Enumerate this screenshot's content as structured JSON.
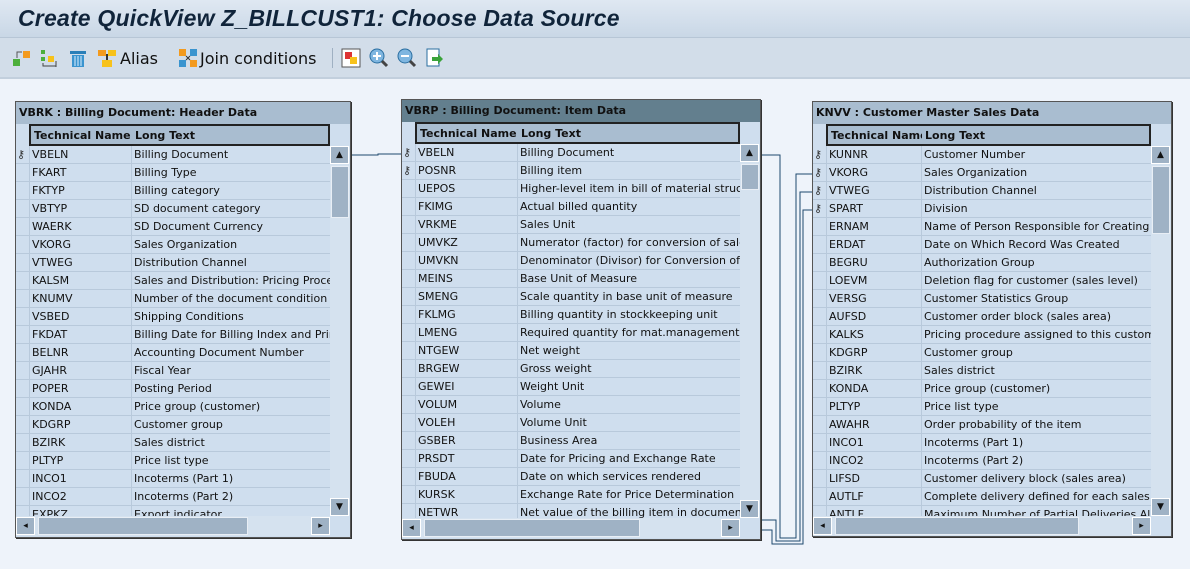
{
  "title": "Create QuickView Z_BILLCUST1: Choose Data Source",
  "toolbar": {
    "alias": "Alias",
    "join": "Join conditions"
  },
  "colors": {
    "line": "#1f4a6e",
    "header": "#a9bdd0",
    "selected_header": "#637f8e"
  },
  "tables": [
    {
      "title": "VBRK : Billing Document: Header Data",
      "col_tech": "Technical Name",
      "col_long": "Long Text",
      "rows": [
        [
          "VBELN",
          "Billing Document",
          true
        ],
        [
          "FKART",
          "Billing Type",
          false
        ],
        [
          "FKTYP",
          "Billing category",
          false
        ],
        [
          "VBTYP",
          "SD document category",
          false
        ],
        [
          "WAERK",
          "SD Document Currency",
          false
        ],
        [
          "VKORG",
          "Sales Organization",
          false
        ],
        [
          "VTWEG",
          "Distribution Channel",
          false
        ],
        [
          "KALSM",
          "Sales and Distribution: Pricing Procedure",
          false
        ],
        [
          "KNUMV",
          "Number of the document condition",
          false
        ],
        [
          "VSBED",
          "Shipping Conditions",
          false
        ],
        [
          "FKDAT",
          "Billing Date for Billing Index and Printout",
          false
        ],
        [
          "BELNR",
          "Accounting Document Number",
          false
        ],
        [
          "GJAHR",
          "Fiscal Year",
          false
        ],
        [
          "POPER",
          "Posting Period",
          false
        ],
        [
          "KONDA",
          "Price group (customer)",
          false
        ],
        [
          "KDGRP",
          "Customer group",
          false
        ],
        [
          "BZIRK",
          "Sales district",
          false
        ],
        [
          "PLTYP",
          "Price list type",
          false
        ],
        [
          "INCO1",
          "Incoterms (Part 1)",
          false
        ],
        [
          "INCO2",
          "Incoterms (Part 2)",
          false
        ],
        [
          "EXPKZ",
          "Export indicator",
          false
        ]
      ]
    },
    {
      "title": "VBRP : Billing Document: Item Data",
      "col_tech": "Technical Name",
      "col_long": "Long Text",
      "rows": [
        [
          "VBELN",
          "Billing Document",
          true
        ],
        [
          "POSNR",
          "Billing item",
          true
        ],
        [
          "UEPOS",
          "Higher-level item in bill of material structures",
          false
        ],
        [
          "FKIMG",
          "Actual billed quantity",
          false
        ],
        [
          "VRKME",
          "Sales Unit",
          false
        ],
        [
          "UMVKZ",
          "Numerator (factor) for conversion of sales quantity",
          false
        ],
        [
          "UMVKN",
          "Denominator (Divisor) for Conversion of Sales Qty",
          false
        ],
        [
          "MEINS",
          "Base Unit of Measure",
          false
        ],
        [
          "SMENG",
          "Scale quantity in base unit of measure",
          false
        ],
        [
          "FKLMG",
          "Billing quantity in stockkeeping unit",
          false
        ],
        [
          "LMENG",
          "Required quantity for mat.management in stock",
          false
        ],
        [
          "NTGEW",
          "Net weight",
          false
        ],
        [
          "BRGEW",
          "Gross weight",
          false
        ],
        [
          "GEWEI",
          "Weight Unit",
          false
        ],
        [
          "VOLUM",
          "Volume",
          false
        ],
        [
          "VOLEH",
          "Volume Unit",
          false
        ],
        [
          "GSBER",
          "Business Area",
          false
        ],
        [
          "PRSDT",
          "Date for Pricing and Exchange Rate",
          false
        ],
        [
          "FBUDA",
          "Date on which services rendered",
          false
        ],
        [
          "KURSK",
          "Exchange Rate for Price Determination",
          false
        ],
        [
          "NETWR",
          "Net value of the billing item in document currency",
          false
        ]
      ]
    },
    {
      "title": "KNVV : Customer Master Sales Data",
      "col_tech": "Technical Name",
      "col_long": "Long Text",
      "rows": [
        [
          "KUNNR",
          "Customer Number",
          true
        ],
        [
          "VKORG",
          "Sales Organization",
          true
        ],
        [
          "VTWEG",
          "Distribution Channel",
          true
        ],
        [
          "SPART",
          "Division",
          true
        ],
        [
          "ERNAM",
          "Name of Person Responsible for Creating the Object",
          false
        ],
        [
          "ERDAT",
          "Date on Which Record Was Created",
          false
        ],
        [
          "BEGRU",
          "Authorization Group",
          false
        ],
        [
          "LOEVM",
          "Deletion flag for customer (sales level)",
          false
        ],
        [
          "VERSG",
          "Customer Statistics Group",
          false
        ],
        [
          "AUFSD",
          "Customer order block (sales area)",
          false
        ],
        [
          "KALKS",
          "Pricing procedure assigned to this customer",
          false
        ],
        [
          "KDGRP",
          "Customer group",
          false
        ],
        [
          "BZIRK",
          "Sales district",
          false
        ],
        [
          "KONDA",
          "Price group (customer)",
          false
        ],
        [
          "PLTYP",
          "Price list type",
          false
        ],
        [
          "AWAHR",
          "Order probability of the item",
          false
        ],
        [
          "INCO1",
          "Incoterms (Part 1)",
          false
        ],
        [
          "INCO2",
          "Incoterms (Part 2)",
          false
        ],
        [
          "LIFSD",
          "Customer delivery block (sales area)",
          false
        ],
        [
          "AUTLF",
          "Complete delivery defined for each sales order?",
          false
        ],
        [
          "ANTLF",
          "Maximum Number of Partial Deliveries Allowed Per Item",
          false
        ]
      ]
    }
  ]
}
